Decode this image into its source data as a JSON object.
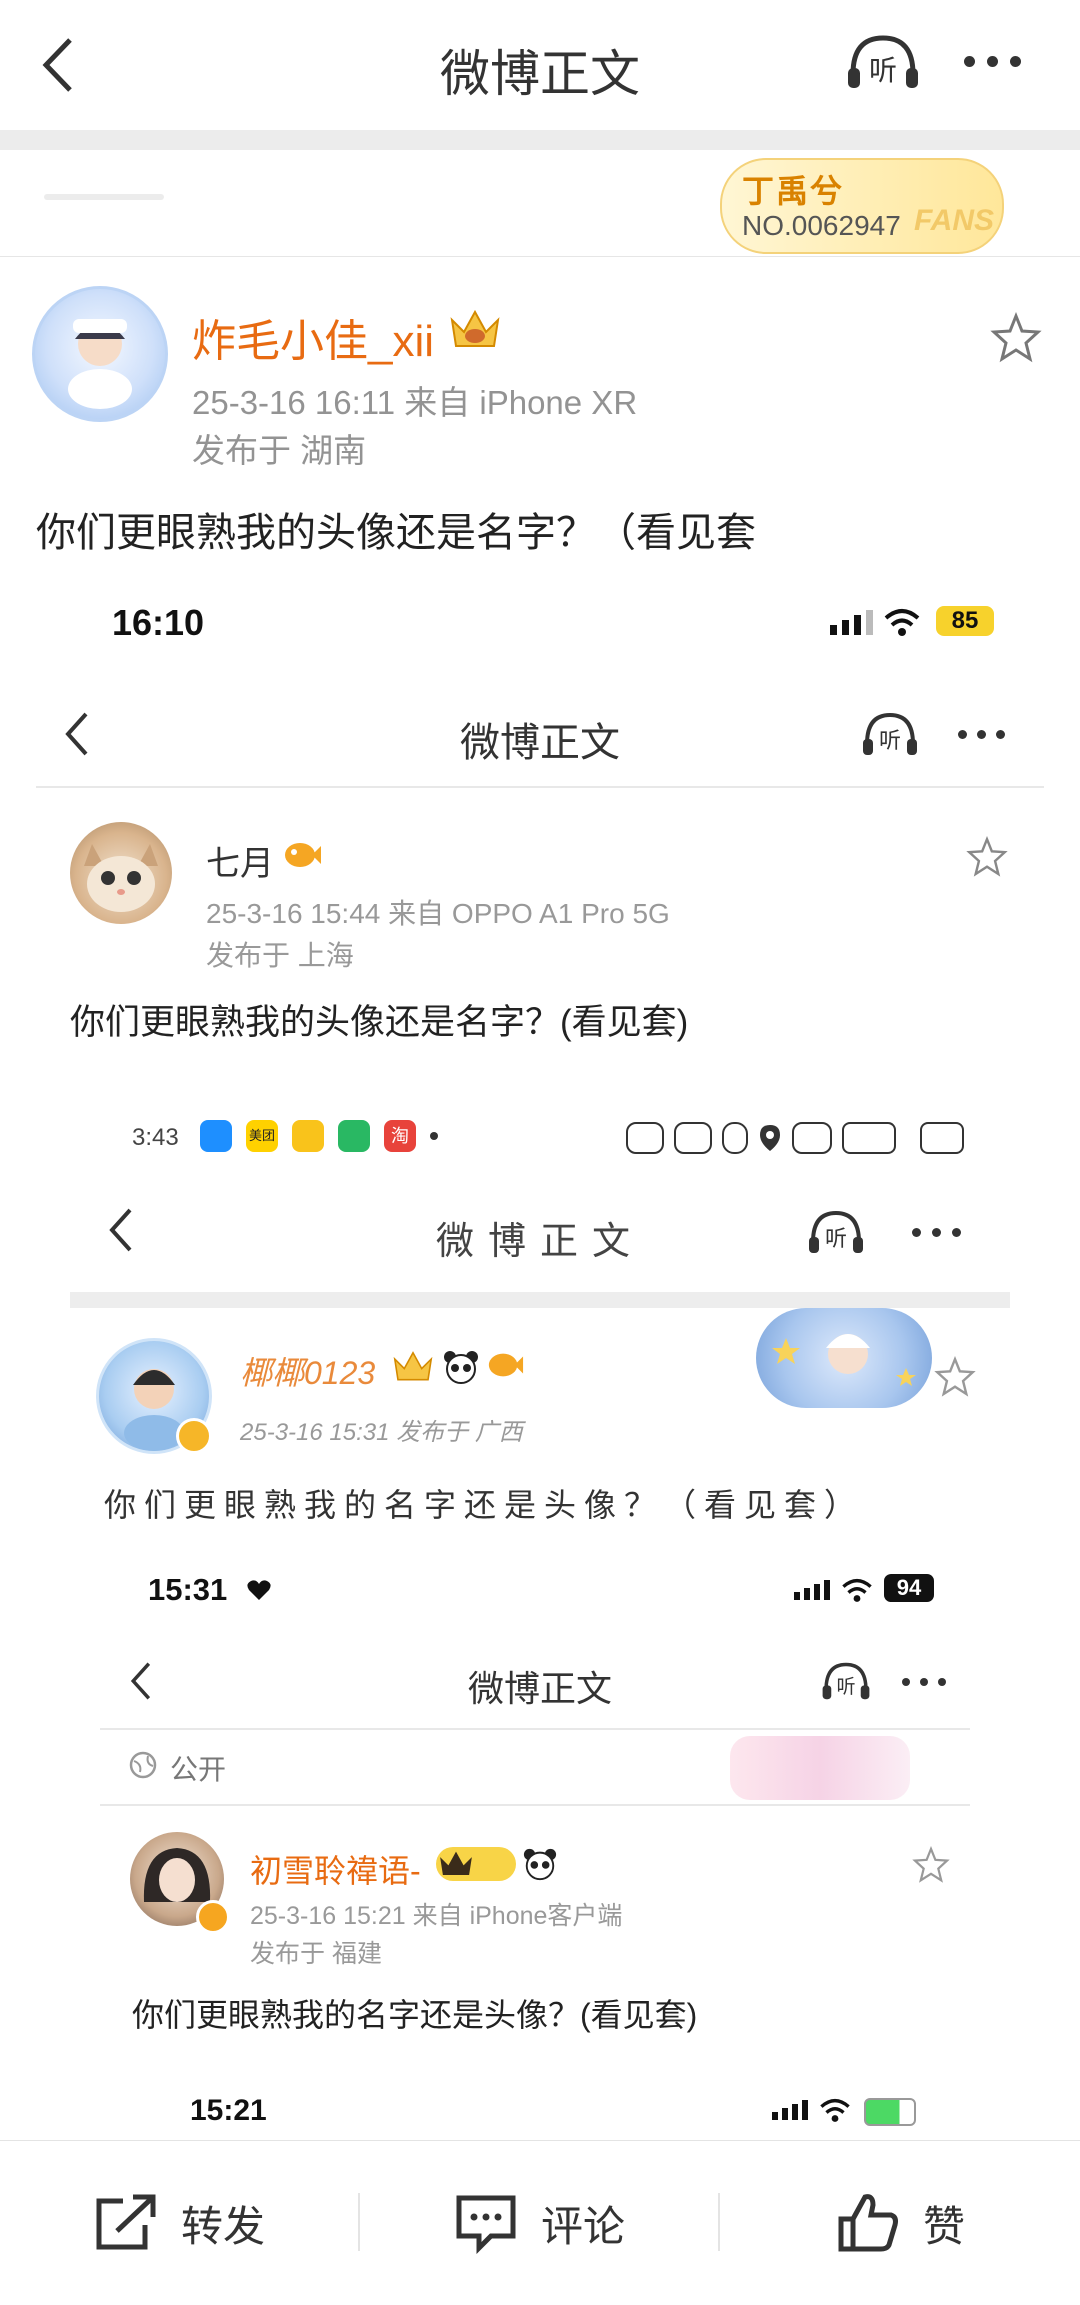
{
  "nav": {
    "title": "微博正文",
    "listen_label": "听"
  },
  "fans": {
    "title": "丁禹兮",
    "number": "NO.0062947",
    "word": "FANS"
  },
  "post": {
    "username": "炸毛小佳_xii",
    "time_source": "25-3-16 16:11   来自 iPhone XR",
    "location": "发布于 湖南",
    "text": "你们更眼熟我的头像还是名字？（看见套"
  },
  "shot1": {
    "status_time": "16:10",
    "battery": "85",
    "nav_title": "微博正文",
    "listen_label": "听",
    "username": "七月",
    "time_source": "25-3-16 15:44  来自 OPPO A1 Pro 5G",
    "location": "发布于 上海",
    "text": "你们更眼熟我的头像还是名字？(看见套)"
  },
  "shot2": {
    "status_time": "3:43",
    "app_icons": [
      "美团",
      "淘"
    ],
    "nav_title": "微博正文",
    "listen_label": "听",
    "username": "椰椰0123",
    "time_source": "25-3-16 15:31   发布于 广西",
    "text": "你们更眼熟我的名字还是头像？（看见套）"
  },
  "shot3": {
    "status_time": "15:31",
    "battery": "94",
    "nav_title": "微博正文",
    "listen_label": "听",
    "visibility": "公开",
    "username": "初雪聆禕语-",
    "time_source": "25-3-16 15:21  来自 iPhone客户端",
    "location": "发布于 福建",
    "text": "你们更眼熟我的名字还是头像？(看见套)"
  },
  "shot4": {
    "status_time": "15:21"
  },
  "bottom": {
    "repost": "转发",
    "comment": "评论",
    "like": "赞"
  },
  "colors": {
    "accent_orange": "#e86b12",
    "meta_gray": "#939393",
    "gold": "#f6c544"
  }
}
